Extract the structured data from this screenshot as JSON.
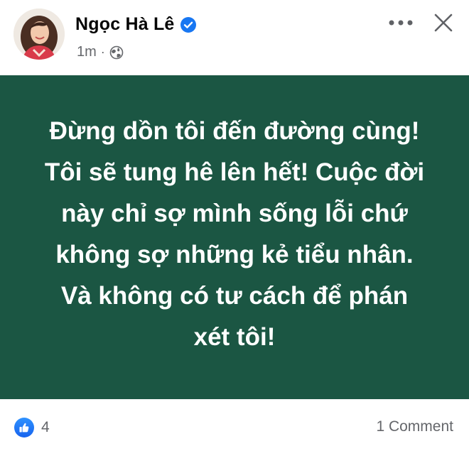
{
  "header": {
    "author_name": "Ngọc Hà Lê",
    "time_ago": "1m",
    "separator": "·",
    "icons": {
      "verified": "verified-badge-icon",
      "audience": "globe-icon",
      "more": "more-options-icon",
      "close": "close-icon"
    }
  },
  "post": {
    "background_color": "#1b5643",
    "lines": [
      "Đừng dồn tôi đến đường cùng!",
      "Tôi sẽ tung hê lên hết! Cuộc đời",
      "này chỉ sợ mình sống lỗi chứ",
      "không sợ những kẻ tiểu nhân.",
      "Và không có tư cách để phán",
      "xét tôi!"
    ]
  },
  "footer": {
    "reaction_icon": "like-icon",
    "reaction_count": "4",
    "comments_label": "1 Comment"
  },
  "colors": {
    "accent": "#1877f2",
    "secondary_text": "#65676b"
  }
}
